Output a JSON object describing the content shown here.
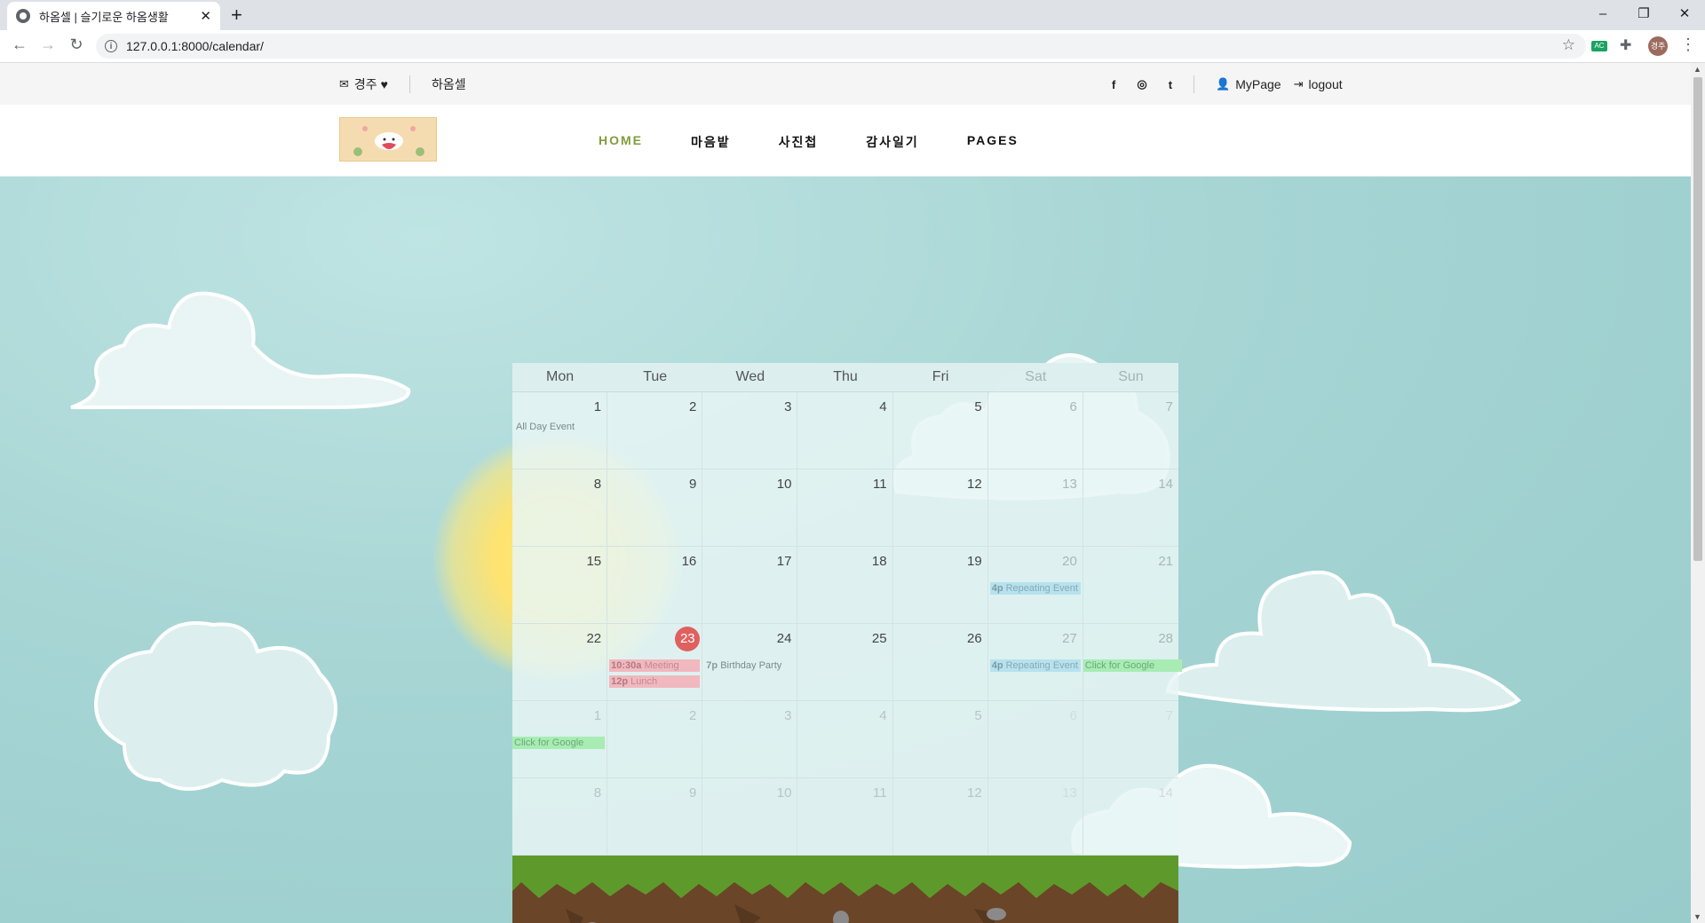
{
  "browser": {
    "tab_title": "하옴셀 | 슬기로운 하옴생활",
    "new_tab": "+",
    "url": "127.0.0.1:8000/calendar/",
    "window_buttons": [
      "–",
      "❐",
      "✕"
    ],
    "profile_label": "경주",
    "ext_label": "AC"
  },
  "topbar": {
    "user_label": "경주",
    "heart": "♥",
    "site_name": "하옴셀",
    "mypage": "MyPage",
    "logout": "logout",
    "social": [
      "f",
      "◎",
      "t"
    ]
  },
  "nav": {
    "items": [
      "HOME",
      "마음밭",
      "사진첩",
      "감사일기",
      "PAGES"
    ]
  },
  "calendar": {
    "weekdays": [
      "Mon",
      "Tue",
      "Wed",
      "Thu",
      "Fri",
      "Sat",
      "Sun"
    ],
    "today": "23",
    "weeks": [
      [
        "1",
        "2",
        "3",
        "4",
        "5",
        "6",
        "7"
      ],
      [
        "8",
        "9",
        "10",
        "11",
        "12",
        "13",
        "14"
      ],
      [
        "15",
        "16",
        "17",
        "18",
        "19",
        "20",
        "21"
      ],
      [
        "22",
        "23",
        "24",
        "25",
        "26",
        "27",
        "28"
      ],
      [
        "1",
        "2",
        "3",
        "4",
        "5",
        "6",
        "7"
      ],
      [
        "8",
        "9",
        "10",
        "11",
        "12",
        "13",
        "14"
      ]
    ],
    "events": {
      "all_day": "All Day Event",
      "repeat_time": "4p",
      "repeat_title": "Repeating Event",
      "meeting_time": "10:30a",
      "meeting_title": "Meeting",
      "lunch_time": "12p",
      "lunch_title": "Lunch",
      "party_time": "7p",
      "party_title": "Birthday Party",
      "google": "Click for Google"
    }
  }
}
